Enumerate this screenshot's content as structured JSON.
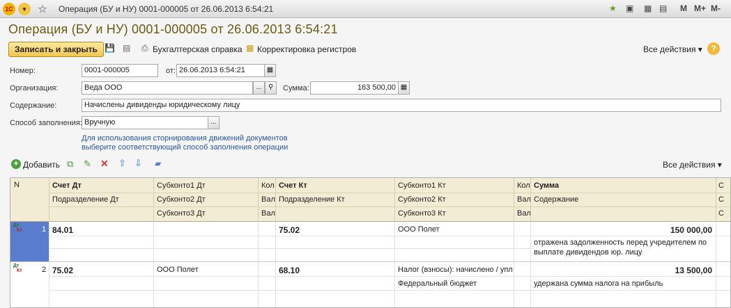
{
  "window": {
    "title": "Операция (БУ и НУ) 0001-000005 от 26.06.2013 6:54:21",
    "m_buttons": [
      "M",
      "M+",
      "M-"
    ]
  },
  "document": {
    "title": "Операция (БУ и НУ) 0001-000005 от 26.06.2013 6:54:21"
  },
  "toolbar": {
    "save_close": "Записать и закрыть",
    "accounting_ref": "Бухгалтерская справка",
    "correction": "Корректировка регистров",
    "all_actions": "Все действия ▾",
    "help": "?"
  },
  "form": {
    "number_label": "Номер:",
    "number_value": "0001-000005",
    "date_label": "от:",
    "date_value": "26.06.2013  6:54:21",
    "org_label": "Организация:",
    "org_value": "Веда ООО",
    "sum_label": "Сумма:",
    "sum_value": "163 500,00",
    "content_label": "Содержание:",
    "content_value": "Начислены дивиденды юридическому лицу",
    "fill_label": "Способ заполнения:",
    "fill_value": "Вручную",
    "hint_line1": "Для использования сторнирования движений документов",
    "hint_line2": "выберите соответствующий способ заполнения операции"
  },
  "table_toolbar": {
    "add": "Добавить",
    "all_actions": "Все действия ▾"
  },
  "table": {
    "headers": {
      "n": "N",
      "dt": "Счет Дт",
      "sub1dt": "Субконто1 Дт",
      "sub2dt": "Субконто2 Дт",
      "sub3dt": "Субконто3 Дт",
      "kol1": "Кол",
      "val1": "Вал",
      "val2": "Вал",
      "kt": "Счет Кт",
      "div_dt": "Подразделение Дт",
      "div_kt": "Подразделение Кт",
      "sub1kt": "Субконто1 Кт",
      "sub2kt": "Субконто2 Кт",
      "sub3kt": "Субконто3 Кт",
      "kol2": "Кол",
      "val3": "Вал",
      "val4": "Вал",
      "sum": "Сумма",
      "content": "Содержание",
      "extra1": "С",
      "extra2": "С",
      "extra3": "С"
    },
    "rows": [
      {
        "n": "1",
        "icon_top": "Дт",
        "icon_bottom": "Кт",
        "dt": "84.01",
        "sub1dt": "",
        "kt": "75.02",
        "sub1kt": "ООО Полет",
        "sub2kt": "",
        "sum": "150 000,00",
        "content_line1": "отражена задолженность перед учредителем по",
        "content_line2": "выплате дивидендов юр. лицу"
      },
      {
        "n": "2",
        "icon_top": "Дт",
        "icon_bottom": "Кт",
        "dt": "75.02",
        "sub1dt": "ООО Полет",
        "kt": "68.10",
        "sub1kt": "Налог (взносы): начислено / упл",
        "sub2kt": "Федеральный бюджет",
        "sum": "13 500,00",
        "content_line1": "удержана сумма налога на прибыль",
        "content_line2": ""
      }
    ]
  },
  "colors": {
    "header_bg": "#f1ecd3",
    "selected_cell": "#5a7ccc",
    "title_color": "#6b5a10",
    "link_color": "#2a57a8"
  }
}
